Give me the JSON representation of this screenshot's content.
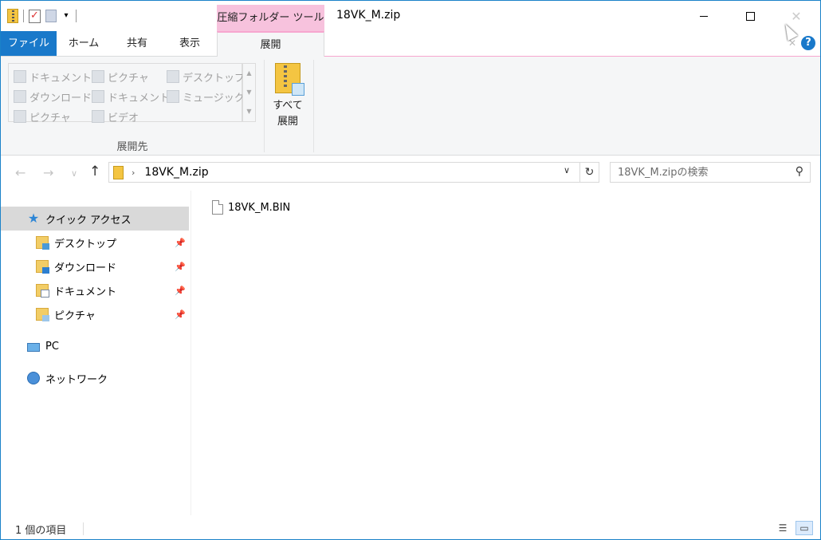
{
  "titlebar": {
    "contextual_tab_title": "圧縮フォルダー ツール",
    "window_title": "18VK_M.zip",
    "close_glyph": "✕"
  },
  "ribbon": {
    "tabs": [
      {
        "label": "ファイル"
      },
      {
        "label": "ホーム"
      },
      {
        "label": "共有"
      },
      {
        "label": "表示"
      },
      {
        "label": "展開"
      }
    ],
    "help_label": "?",
    "gallery": [
      {
        "label": "ドキュメント",
        "icon": "documents-icon"
      },
      {
        "label": "ピクチャ",
        "icon": "pictures-icon"
      },
      {
        "label": "デスクトップ",
        "icon": "desktop-icon"
      },
      {
        "label": "ダウンロード",
        "icon": "downloads-icon"
      },
      {
        "label": "ドキュメント",
        "icon": "documents-icon"
      },
      {
        "label": "ミュージック",
        "icon": "music-icon"
      },
      {
        "label": "ピクチャ",
        "icon": "pictures-icon"
      },
      {
        "label": "ビデオ",
        "icon": "videos-icon"
      }
    ],
    "group_label": "展開先",
    "extract_all_line1": "すべて",
    "extract_all_line2": "展開"
  },
  "addressbar": {
    "path": "18VK_M.zip",
    "search_placeholder": "18VK_M.zipの検索"
  },
  "navpane": {
    "quick_access": "クイック アクセス",
    "pinned": [
      {
        "label": "デスクトップ"
      },
      {
        "label": "ダウンロード"
      },
      {
        "label": "ドキュメント"
      },
      {
        "label": "ピクチャ"
      }
    ],
    "pc": "PC",
    "network": "ネットワーク"
  },
  "content": {
    "files": [
      {
        "name": "18VK_M.BIN"
      }
    ]
  },
  "statusbar": {
    "item_count": "1 個の項目"
  },
  "colors": {
    "accent": "#1979ca",
    "contextual_tab": "#f7c2dd",
    "selection": "#d9d9d9"
  }
}
